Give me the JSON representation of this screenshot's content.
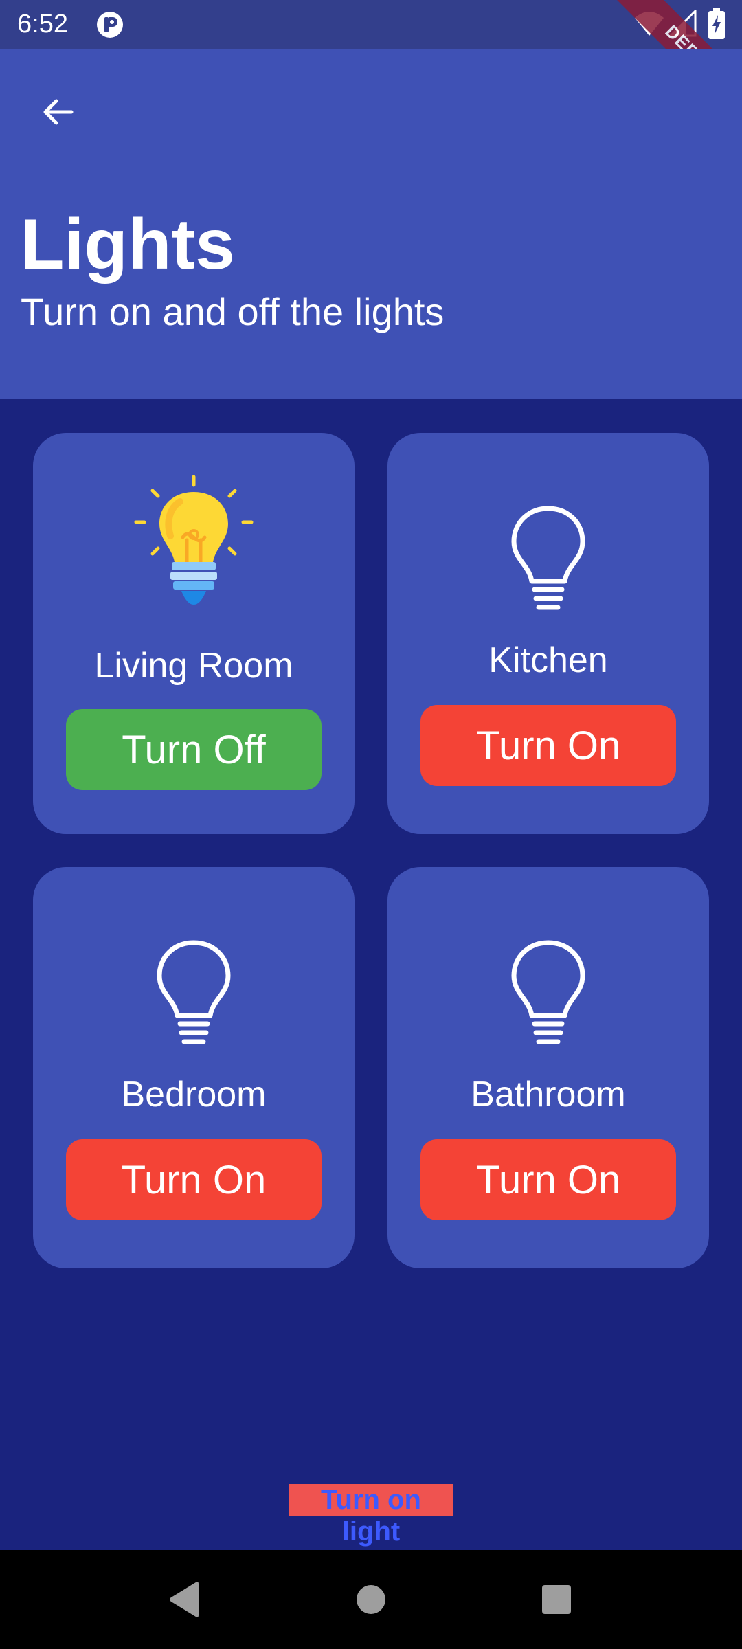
{
  "status_bar": {
    "time": "6:52",
    "debug_banner": "DEBUG"
  },
  "header": {
    "title": "Lights",
    "subtitle": "Turn on and off the lights"
  },
  "rooms": [
    {
      "name": "Living Room",
      "button_label": "Turn Off",
      "light_on": true
    },
    {
      "name": "Kitchen",
      "button_label": "Turn On",
      "light_on": false
    },
    {
      "name": "Bedroom",
      "button_label": "Turn On",
      "light_on": false
    },
    {
      "name": "Bathroom",
      "button_label": "Turn On",
      "light_on": false
    }
  ],
  "footer": {
    "status_text": "Turn on light"
  },
  "colors": {
    "status_bar": "#333f8c",
    "app_bar": "#3f51b5",
    "background": "#1a237e",
    "card": "#3f51b5",
    "button_on_green": "#4caf50",
    "button_off_red": "#f44336"
  },
  "icons": {
    "back": "arrow-back-icon",
    "bulb_on": "lightbulb-lit-icon",
    "bulb_off": "lightbulb-outline-icon"
  }
}
